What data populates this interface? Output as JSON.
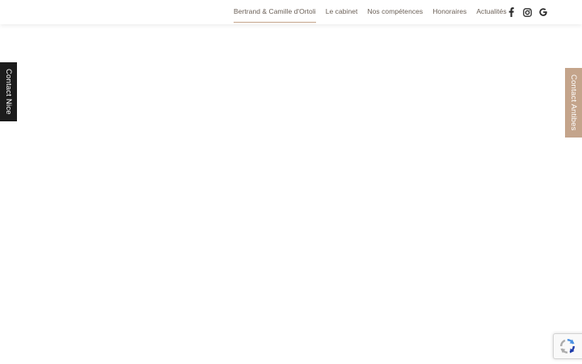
{
  "nav": {
    "items": [
      {
        "label": "Bertrand & Camille d'Ortoli",
        "active": true
      },
      {
        "label": "Le cabinet",
        "active": false
      },
      {
        "label": "Nos compétences",
        "active": false
      },
      {
        "label": "Honoraires",
        "active": false
      },
      {
        "label": "Actualités",
        "active": false
      }
    ]
  },
  "social": {
    "icons": [
      "facebook-icon",
      "instagram-icon",
      "google-icon"
    ],
    "color": "#2b2b2b"
  },
  "side_tabs": {
    "nice_label": "Contact Nice",
    "antibes_label": "Contact Antibes"
  },
  "colors": {
    "accent": "#c4a48b",
    "dark_tab": "#1c1c1c",
    "nav_text": "#6a5f56"
  },
  "recaptcha": {
    "icon": "recaptcha-icon"
  }
}
